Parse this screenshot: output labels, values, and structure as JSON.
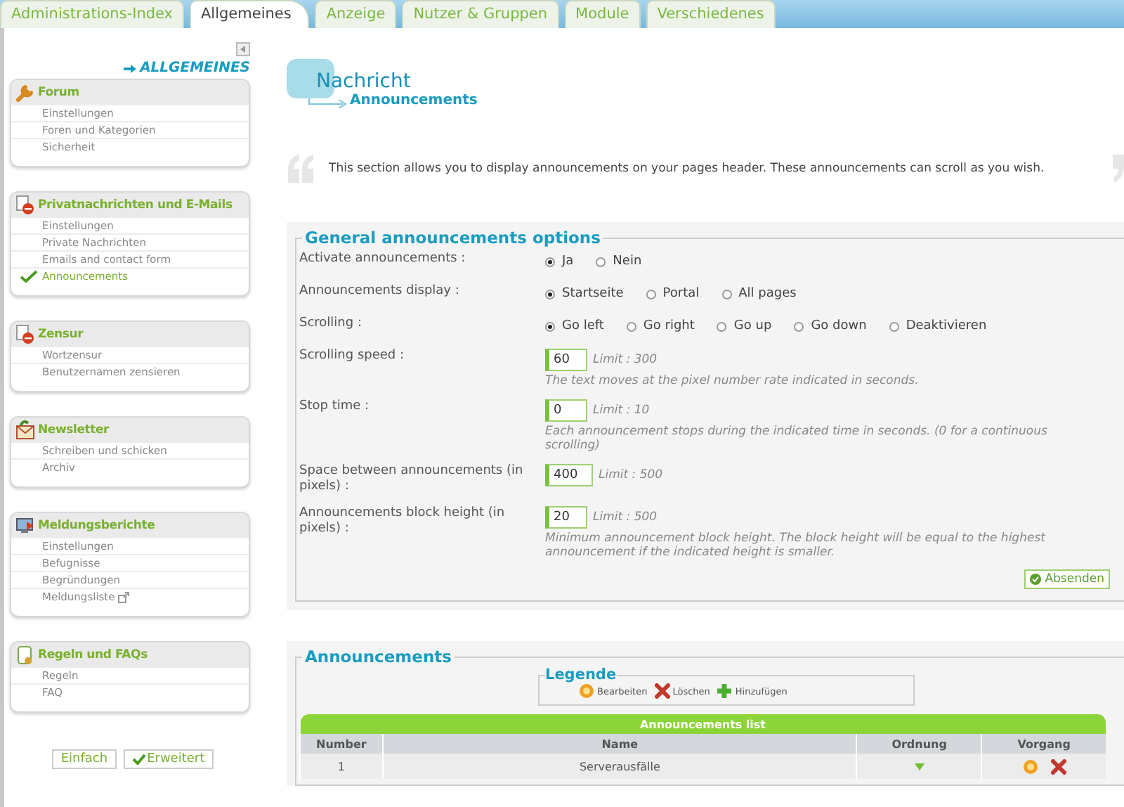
{
  "tabs": [
    {
      "label": "Administrations-Index",
      "selected": false
    },
    {
      "label": "Allgemeines",
      "selected": true
    },
    {
      "label": "Anzeige",
      "selected": false
    },
    {
      "label": "Nutzer & Gruppen",
      "selected": false
    },
    {
      "label": "Module",
      "selected": false
    },
    {
      "label": "Verschiedenes",
      "selected": false
    }
  ],
  "sidebar": {
    "heading": "ALLGEMEINES",
    "groups": [
      {
        "kind": "forum",
        "title": "Forum",
        "items": [
          {
            "label": "Einstellungen",
            "selected": false,
            "external": false
          },
          {
            "label": "Foren und Kategorien",
            "selected": false,
            "external": false
          },
          {
            "label": "Sicherheit",
            "selected": false,
            "external": false
          }
        ]
      },
      {
        "kind": "blocked",
        "title": "Privatnachrichten und E-Mails",
        "items": [
          {
            "label": "Einstellungen",
            "selected": false,
            "external": false
          },
          {
            "label": "Private Nachrichten",
            "selected": false,
            "external": false
          },
          {
            "label": "Emails and contact form",
            "selected": false,
            "external": false
          },
          {
            "label": "Announcements",
            "selected": true,
            "external": false
          }
        ]
      },
      {
        "kind": "blocked",
        "title": "Zensur",
        "items": [
          {
            "label": "Wortzensur",
            "selected": false,
            "external": false
          },
          {
            "label": "Benutzernamen zensieren",
            "selected": false,
            "external": false
          }
        ]
      },
      {
        "kind": "newsletter",
        "title": "Newsletter",
        "items": [
          {
            "label": "Schreiben und schicken",
            "selected": false,
            "external": false
          },
          {
            "label": "Archiv",
            "selected": false,
            "external": false
          }
        ]
      },
      {
        "kind": "reports",
        "title": "Meldungsberichte",
        "items": [
          {
            "label": "Einstellungen",
            "selected": false,
            "external": false
          },
          {
            "label": "Befugnisse",
            "selected": false,
            "external": false
          },
          {
            "label": "Begründungen",
            "selected": false,
            "external": false
          },
          {
            "label": "Meldungsliste",
            "selected": false,
            "external": true
          }
        ]
      },
      {
        "kind": "rules",
        "title": "Regeln und FAQs",
        "items": [
          {
            "label": "Regeln",
            "selected": false,
            "external": false
          },
          {
            "label": "FAQ",
            "selected": false,
            "external": false
          }
        ]
      }
    ],
    "view_buttons": [
      {
        "label": "Einfach",
        "selected": false
      },
      {
        "label": "Erweitert",
        "selected": true
      }
    ]
  },
  "page": {
    "title": "Nachricht",
    "subtitle": "Announcements",
    "intro": "This section allows you to display announcements on your pages header. These announcements can scroll as you wish."
  },
  "options": {
    "legend": "General announcements options",
    "rows": [
      {
        "kind": "radio",
        "label": "Activate announcements :",
        "options": [
          {
            "label": "Ja",
            "selected": true
          },
          {
            "label": "Nein",
            "selected": false
          }
        ]
      },
      {
        "kind": "radio",
        "label": "Announcements display :",
        "options": [
          {
            "label": "Startseite",
            "selected": true
          },
          {
            "label": "Portal",
            "selected": false
          },
          {
            "label": "All pages",
            "selected": false
          }
        ]
      },
      {
        "kind": "radio",
        "label": "Scrolling :",
        "options": [
          {
            "label": "Go left",
            "selected": true
          },
          {
            "label": "Go right",
            "selected": false
          },
          {
            "label": "Go up",
            "selected": false
          },
          {
            "label": "Go down",
            "selected": false
          },
          {
            "label": "Deaktivieren",
            "selected": false
          }
        ]
      },
      {
        "kind": "number",
        "label": "Scrolling speed :",
        "value": "60",
        "limit": "Limit : 300",
        "hint": "The text moves at the pixel number rate indicated in seconds."
      },
      {
        "kind": "number",
        "label": "Stop time :",
        "value": "0",
        "limit": "Limit : 10",
        "hint": "Each announcement stops during the indicated time in seconds. (0 for a continuous scrolling)"
      },
      {
        "kind": "number",
        "label": "Space between announcements (in pixels) :",
        "value": "400",
        "limit": "Limit : 500"
      },
      {
        "kind": "number",
        "label": "Announcements block height (in pixels) :",
        "value": "20",
        "limit": "Limit : 500",
        "hint": "Minimum announcement block height. The block height will be equal to the highest announcement if the indicated height is smaller."
      }
    ],
    "submit": "Absenden"
  },
  "announcements": {
    "legend": "Announcements",
    "key": {
      "title": "Legende",
      "items": [
        {
          "kind": "edit",
          "label": "Bearbeiten"
        },
        {
          "kind": "delete",
          "label": "Löschen"
        },
        {
          "kind": "add",
          "label": "Hinzufügen"
        }
      ]
    },
    "table": {
      "title": "Announcements list",
      "columns": [
        "Number",
        "Name",
        "Ordnung",
        "Vorgang"
      ],
      "rows": [
        {
          "number": "1",
          "name": "Serverausfälle",
          "actions": [
            {
              "kind": "edit"
            },
            {
              "kind": "delete"
            }
          ]
        }
      ]
    }
  }
}
